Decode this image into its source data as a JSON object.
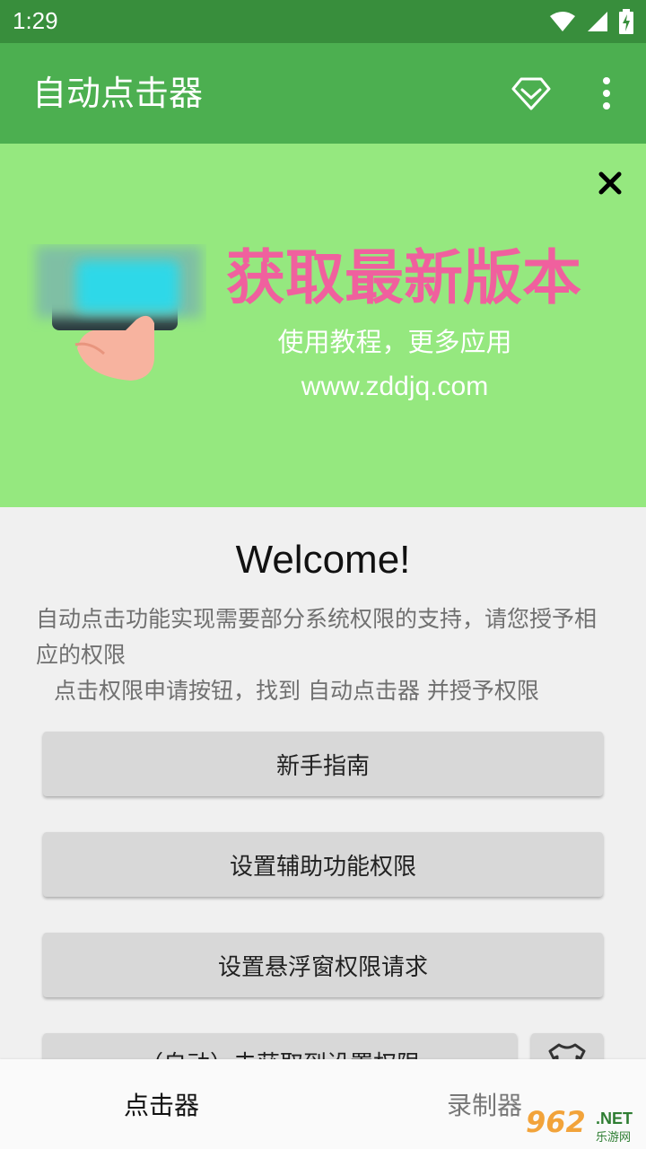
{
  "status_bar": {
    "time": "1:29"
  },
  "app_bar": {
    "title": "自动点击器"
  },
  "banner": {
    "headline": "获取最新版本",
    "subtitle": "使用教程，更多应用",
    "url": "www.zddjq.com"
  },
  "welcome": {
    "title": "Welcome!",
    "description": "自动点击功能实现需要部分系统权限的支持，请您授予相应的权限",
    "instruction": "点击权限申请按钮，找到 自动点击器 并授予权限"
  },
  "buttons": {
    "guide": "新手指南",
    "accessibility": "设置辅助功能权限",
    "overlay": "设置悬浮窗权限请求",
    "autostart_partial": "（自动）去获取到设置权限"
  },
  "bottom_nav": {
    "tabs": [
      {
        "label": "点击器",
        "active": true
      },
      {
        "label": "录制器",
        "active": false
      }
    ]
  },
  "watermark": {
    "brand": "962",
    "suffix": ".NET",
    "site": "乐游网"
  },
  "colors": {
    "status_bar": "#388e3c",
    "app_bar": "#4caf50",
    "banner_bg": "#95e87f",
    "banner_headline": "#f0609e"
  },
  "icons": {
    "vip": "diamond-icon",
    "more": "more-vert-icon",
    "close": "close-icon",
    "wifi": "wifi-icon",
    "signal": "signal-icon",
    "battery": "battery-charging-icon"
  }
}
